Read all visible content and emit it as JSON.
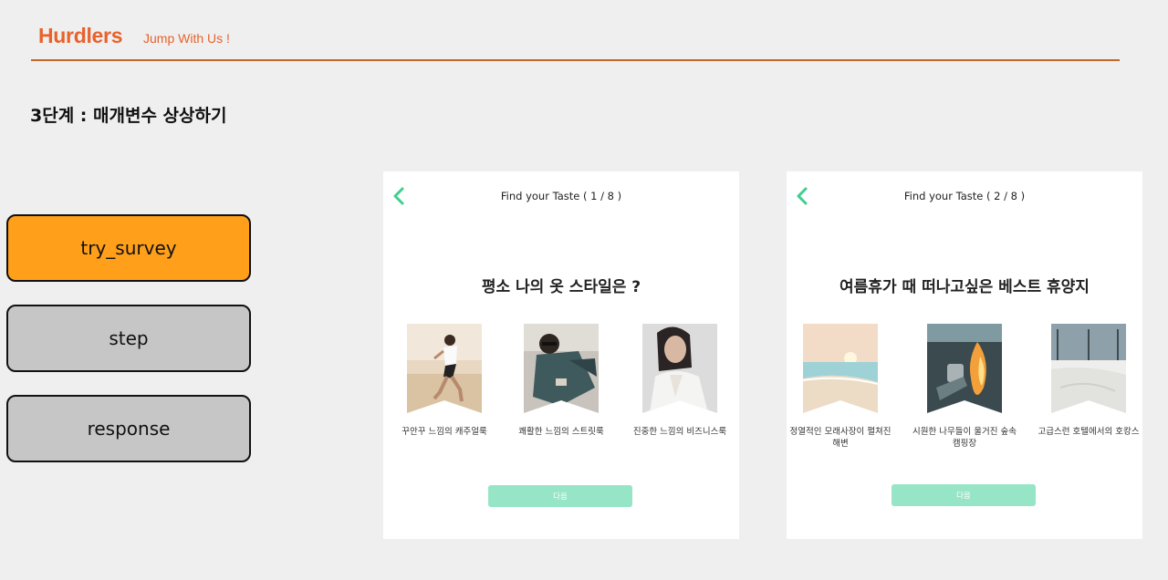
{
  "header": {
    "brand": "Hurdlers",
    "tagline": "Jump With Us !"
  },
  "page": {
    "step_title": "3단계 : 매개변수 상상하기"
  },
  "sidebar": {
    "buttons": [
      {
        "label": "try_survey",
        "state": "active",
        "color": "#ff9f1a"
      },
      {
        "label": "step",
        "state": "inactive",
        "color": "#c6c6c6"
      },
      {
        "label": "response",
        "state": "inactive",
        "color": "#c6c6c6"
      }
    ]
  },
  "panels": [
    {
      "back_icon": "chevron-left-icon",
      "title": "Find your Taste ( 1 / 8 )",
      "question": "평소 나의 옷 스타일은 ?",
      "options": [
        {
          "label": "꾸안꾸 느낌의 캐주얼룩",
          "image": "casual-woman-running-photo"
        },
        {
          "label": "쾌활한 느낌의 스트릿룩",
          "image": "street-style-man-photo"
        },
        {
          "label": "진중한 느낌의 비즈니스룩",
          "image": "business-woman-laughing-photo"
        }
      ],
      "next_label": "다음"
    },
    {
      "back_icon": "chevron-left-icon",
      "title": "Find your Taste ( 2 / 8 )",
      "question": "여름휴가 때 떠나고싶은 베스트 휴양지",
      "options": [
        {
          "label": "정열적인 모래사장이 펼쳐진 해변",
          "image": "beach-sunset-photo"
        },
        {
          "label": "시원한 나무들이 울거진 숲속 캠핑장",
          "image": "campfire-photo"
        },
        {
          "label": "고급스런 호텔에서의 호캉스",
          "image": "hotel-bed-photo"
        }
      ],
      "next_label": "다음"
    }
  ],
  "colors": {
    "brand": "#e8622c",
    "accent_green": "#3ecf8e",
    "next_button": "#96e5c6",
    "background": "#efefef"
  }
}
